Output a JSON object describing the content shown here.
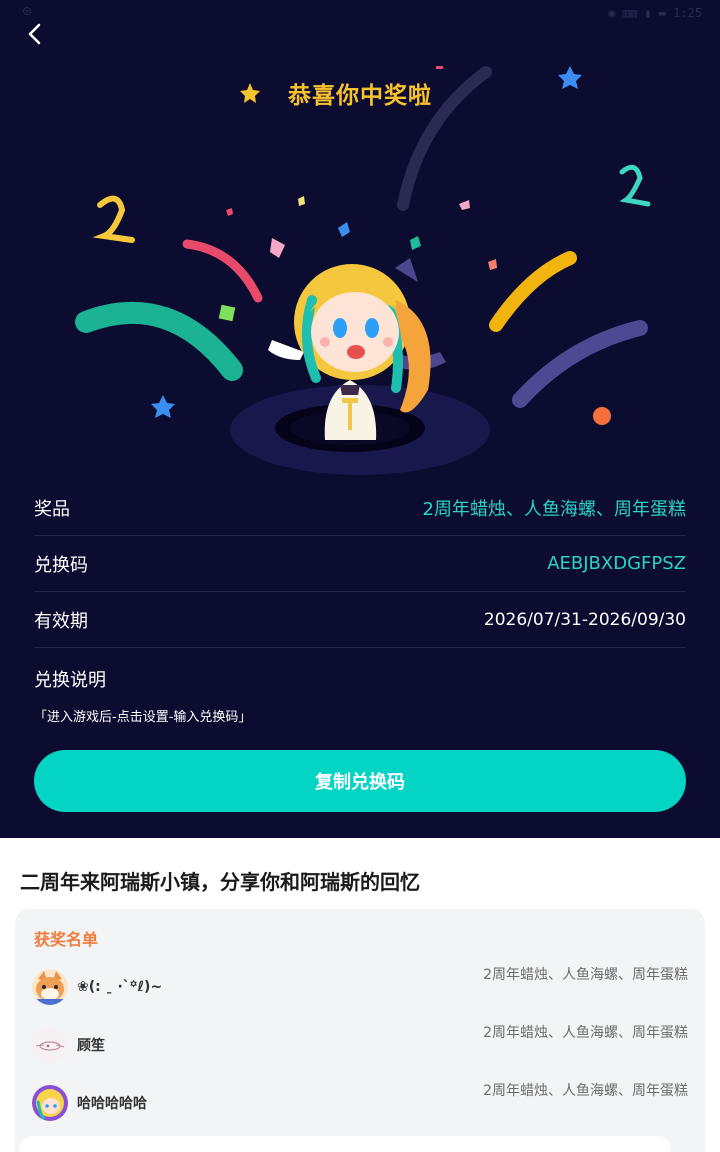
{
  "status": {
    "left": "⊜",
    "right": "◉ ▥▥ ▮ ▬ 1:25"
  },
  "header": {
    "title": "恭喜你中奖啦"
  },
  "details": [
    {
      "label": "奖品",
      "value": "2周年蜡烛、人鱼海螺、周年蛋糕"
    },
    {
      "label": "兑换码",
      "value": "AEBJBXDGFPSZ"
    },
    {
      "label": "有效期",
      "value": "2026/07/31-2026/09/30"
    }
  ],
  "instructions": {
    "label": "兑换说明",
    "text": "「进入游戏后-点击设置-输入兑换码」"
  },
  "copy_button": {
    "label": "复制兑换码"
  },
  "share": {
    "title": "二周年来阿瑞斯小镇，分享你和阿瑞斯的回忆"
  },
  "winners": {
    "title": "获奖名单",
    "items": [
      {
        "name": "❀(:  ˍ  ·`꙳ℓ)~",
        "prize": "2周年蜡烛、人鱼海螺、周年蛋糕"
      },
      {
        "name": "顾笙",
        "prize": "2周年蜡烛、人鱼海螺、周年蛋糕"
      },
      {
        "name": "哈哈哈哈哈",
        "prize": "2周年蜡烛、人鱼海螺、周年蛋糕"
      }
    ]
  },
  "colors": {
    "background": "#0c0b30",
    "accent": "#03d4c3",
    "title": "#f8c22d",
    "list_title": "#f17c3b"
  }
}
